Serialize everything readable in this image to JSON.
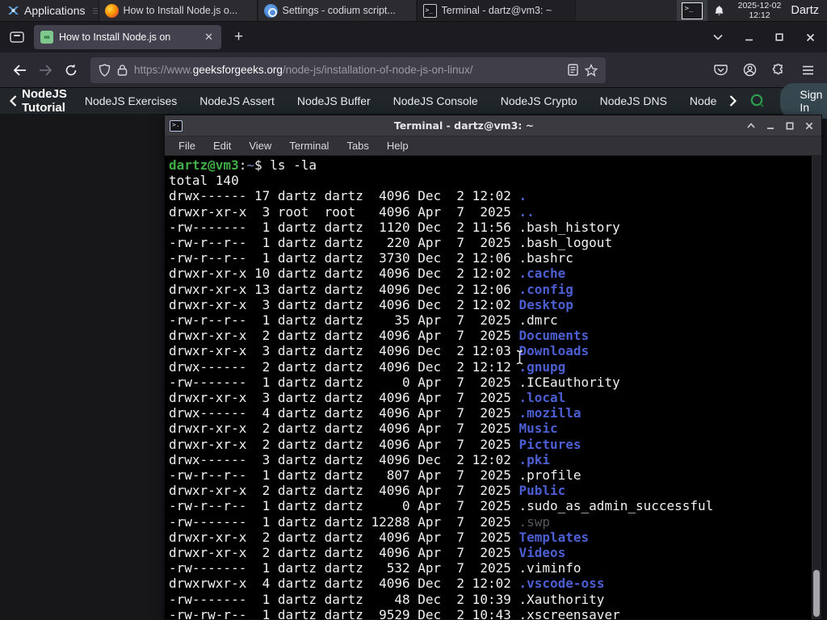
{
  "colors": {
    "panel_bg": "#26262b",
    "firefox_chrome": "#2b2a33",
    "tab_bg": "#42414d",
    "terminal_bg": "#000000",
    "terminal_fg": "#f1f1f1",
    "prompt_green": "#41ad47",
    "dir_blue": "#4c5fd2",
    "gfg_green": "#2f9e4f",
    "signin_bg": "#37474f"
  },
  "panel": {
    "applications_label": "Applications",
    "windows": [
      {
        "icon": "firefox",
        "label": "How to Install Node.js o...",
        "active": false
      },
      {
        "icon": "settings",
        "label": "Settings - codium script...",
        "active": false
      },
      {
        "icon": "terminal",
        "label": "Terminal - dartz@vm3: ~",
        "active": true
      }
    ],
    "clock_date": "2025-12-02",
    "clock_time": "12:12",
    "user": "Dartz"
  },
  "browser": {
    "tab_title": "How to Install Node.js on",
    "url_scheme": "https://www.",
    "url_host": "geeksforgeeks.org",
    "url_path": "/node-js/installation-of-node-js-on-linux/"
  },
  "site_nav": {
    "back_label": "NodeJS Tutorial",
    "items": [
      "NodeJS Exercises",
      "NodeJS Assert",
      "NodeJS Buffer",
      "NodeJS Console",
      "NodeJS Crypto",
      "NodeJS DNS",
      "Node"
    ],
    "signin_label": "Sign In"
  },
  "terminal": {
    "title": "Terminal - dartz@vm3: ~",
    "menu": [
      "File",
      "Edit",
      "View",
      "Terminal",
      "Tabs",
      "Help"
    ],
    "lines": [
      [
        [
          "dartz@vm3",
          "green"
        ],
        [
          ":",
          "fg"
        ],
        [
          "~",
          "tilde"
        ],
        [
          "$ ls -la",
          "fg"
        ]
      ],
      [
        [
          "total 140",
          "fg"
        ]
      ],
      [
        [
          "drwx------ 17 dartz dartz  4096 Dec  2 12:02 ",
          "fg"
        ],
        [
          ".",
          "dir"
        ]
      ],
      [
        [
          "drwxr-xr-x  3 root  root   4096 Apr  7  2025 ",
          "fg"
        ],
        [
          "..",
          "dir"
        ]
      ],
      [
        [
          "-rw-------  1 dartz dartz  1120 Dec  2 11:56 .bash_history",
          "fg"
        ]
      ],
      [
        [
          "-rw-r--r--  1 dartz dartz   220 Apr  7  2025 .bash_logout",
          "fg"
        ]
      ],
      [
        [
          "-rw-r--r--  1 dartz dartz  3730 Dec  2 12:06 .bashrc",
          "fg"
        ]
      ],
      [
        [
          "drwxr-xr-x 10 dartz dartz  4096 Dec  2 12:02 ",
          "fg"
        ],
        [
          ".cache",
          "dir"
        ]
      ],
      [
        [
          "drwxr-xr-x 13 dartz dartz  4096 Dec  2 12:06 ",
          "fg"
        ],
        [
          ".config",
          "dir"
        ]
      ],
      [
        [
          "drwxr-xr-x  3 dartz dartz  4096 Dec  2 12:02 ",
          "fg"
        ],
        [
          "Desktop",
          "dir"
        ]
      ],
      [
        [
          "-rw-r--r--  1 dartz dartz    35 Apr  7  2025 .dmrc",
          "fg"
        ]
      ],
      [
        [
          "drwxr-xr-x  2 dartz dartz  4096 Apr  7  2025 ",
          "fg"
        ],
        [
          "Documents",
          "dir"
        ]
      ],
      [
        [
          "drwxr-xr-x  3 dartz dartz  4096 Dec  2 12:03 ",
          "fg"
        ],
        [
          "Downloads",
          "dir"
        ]
      ],
      [
        [
          "drwx------  2 dartz dartz  4096 Dec  2 12:12 ",
          "fg"
        ],
        [
          ".gnupg",
          "dir"
        ]
      ],
      [
        [
          "-rw-------  1 dartz dartz     0 Apr  7  2025 .ICEauthority",
          "fg"
        ]
      ],
      [
        [
          "drwxr-xr-x  3 dartz dartz  4096 Apr  7  2025 ",
          "fg"
        ],
        [
          ".local",
          "dir"
        ]
      ],
      [
        [
          "drwx------  4 dartz dartz  4096 Apr  7  2025 ",
          "fg"
        ],
        [
          ".mozilla",
          "dir"
        ]
      ],
      [
        [
          "drwxr-xr-x  2 dartz dartz  4096 Apr  7  2025 ",
          "fg"
        ],
        [
          "Music",
          "dir"
        ]
      ],
      [
        [
          "drwxr-xr-x  2 dartz dartz  4096 Apr  7  2025 ",
          "fg"
        ],
        [
          "Pictures",
          "dir"
        ]
      ],
      [
        [
          "drwx------  3 dartz dartz  4096 Dec  2 12:02 ",
          "fg"
        ],
        [
          ".pki",
          "dir"
        ]
      ],
      [
        [
          "-rw-r--r--  1 dartz dartz   807 Apr  7  2025 .profile",
          "fg"
        ]
      ],
      [
        [
          "drwxr-xr-x  2 dartz dartz  4096 Apr  7  2025 ",
          "fg"
        ],
        [
          "Public",
          "dir"
        ]
      ],
      [
        [
          "-rw-r--r--  1 dartz dartz     0 Apr  7  2025 .sudo_as_admin_successful",
          "fg"
        ]
      ],
      [
        [
          "-rw-------  1 dartz dartz 12288 Apr  7  2025 ",
          "fg"
        ],
        [
          ".swp",
          "dim"
        ]
      ],
      [
        [
          "drwxr-xr-x  2 dartz dartz  4096 Apr  7  2025 ",
          "fg"
        ],
        [
          "Templates",
          "dir"
        ]
      ],
      [
        [
          "drwxr-xr-x  2 dartz dartz  4096 Apr  7  2025 ",
          "fg"
        ],
        [
          "Videos",
          "dir"
        ]
      ],
      [
        [
          "-rw-------  1 dartz dartz   532 Apr  7  2025 .viminfo",
          "fg"
        ]
      ],
      [
        [
          "drwxrwxr-x  4 dartz dartz  4096 Dec  2 12:02 ",
          "fg"
        ],
        [
          ".vscode-oss",
          "dir"
        ]
      ],
      [
        [
          "-rw-------  1 dartz dartz    48 Dec  2 10:39 .Xauthority",
          "fg"
        ]
      ],
      [
        [
          "-rw-rw-r--  1 dartz dartz  9529 Dec  2 10:43 .xscreensaver",
          "fg"
        ]
      ]
    ]
  }
}
